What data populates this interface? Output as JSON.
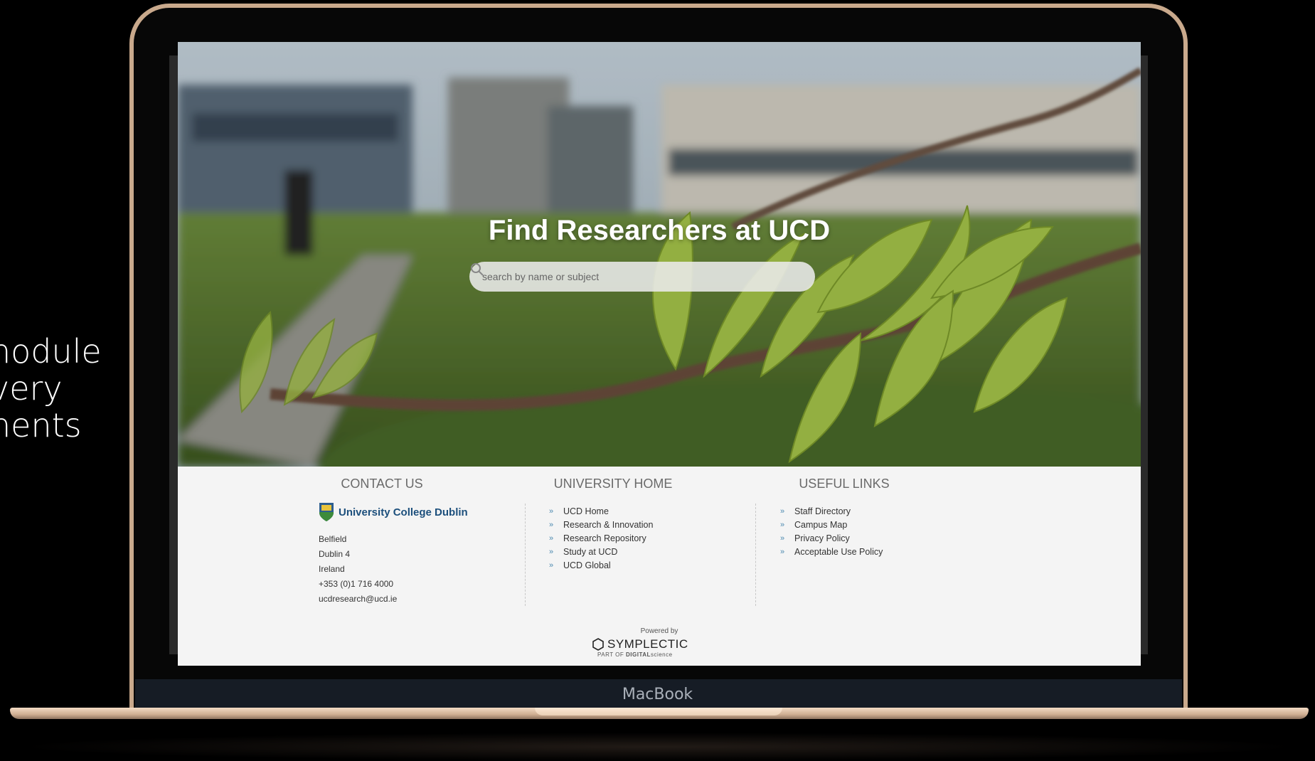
{
  "side_text": [
    "nodule",
    "very",
    "nents"
  ],
  "hero": {
    "title": "Find Researchers at UCD",
    "search_placeholder": "search by name or subject"
  },
  "contact": {
    "heading": "CONTACT US",
    "logo_text": "University College Dublin",
    "address": [
      "Belfield",
      "Dublin 4",
      "Ireland",
      "+353 (0)1 716 4000",
      "ucdresearch@ucd.ie"
    ]
  },
  "university_home": {
    "heading": "UNIVERSITY HOME",
    "links": [
      "UCD Home",
      "Research & Innovation",
      "Research Repository",
      "Study at UCD",
      "UCD Global"
    ]
  },
  "useful_links": {
    "heading": "USEFUL LINKS",
    "links": [
      "Staff Directory",
      "Campus Map",
      "Privacy Policy",
      "Acceptable Use Policy"
    ]
  },
  "powered": {
    "label": "Powered by",
    "brand": "SYMPLECTIC",
    "sub_prefix": "PART OF",
    "sub_brand": "DIGITAL",
    "sub_suffix": "science"
  },
  "device": {
    "label": "MacBook"
  },
  "colors": {
    "link_accent": "#4d8ab0",
    "ucd_blue": "#1c4f7c",
    "footer_bg": "#f4f4f4"
  },
  "icons": {
    "search": "search-icon",
    "chevron": "chevron-right-icon",
    "crest": "ucd-crest-icon",
    "hex": "symplectic-hex-icon"
  }
}
